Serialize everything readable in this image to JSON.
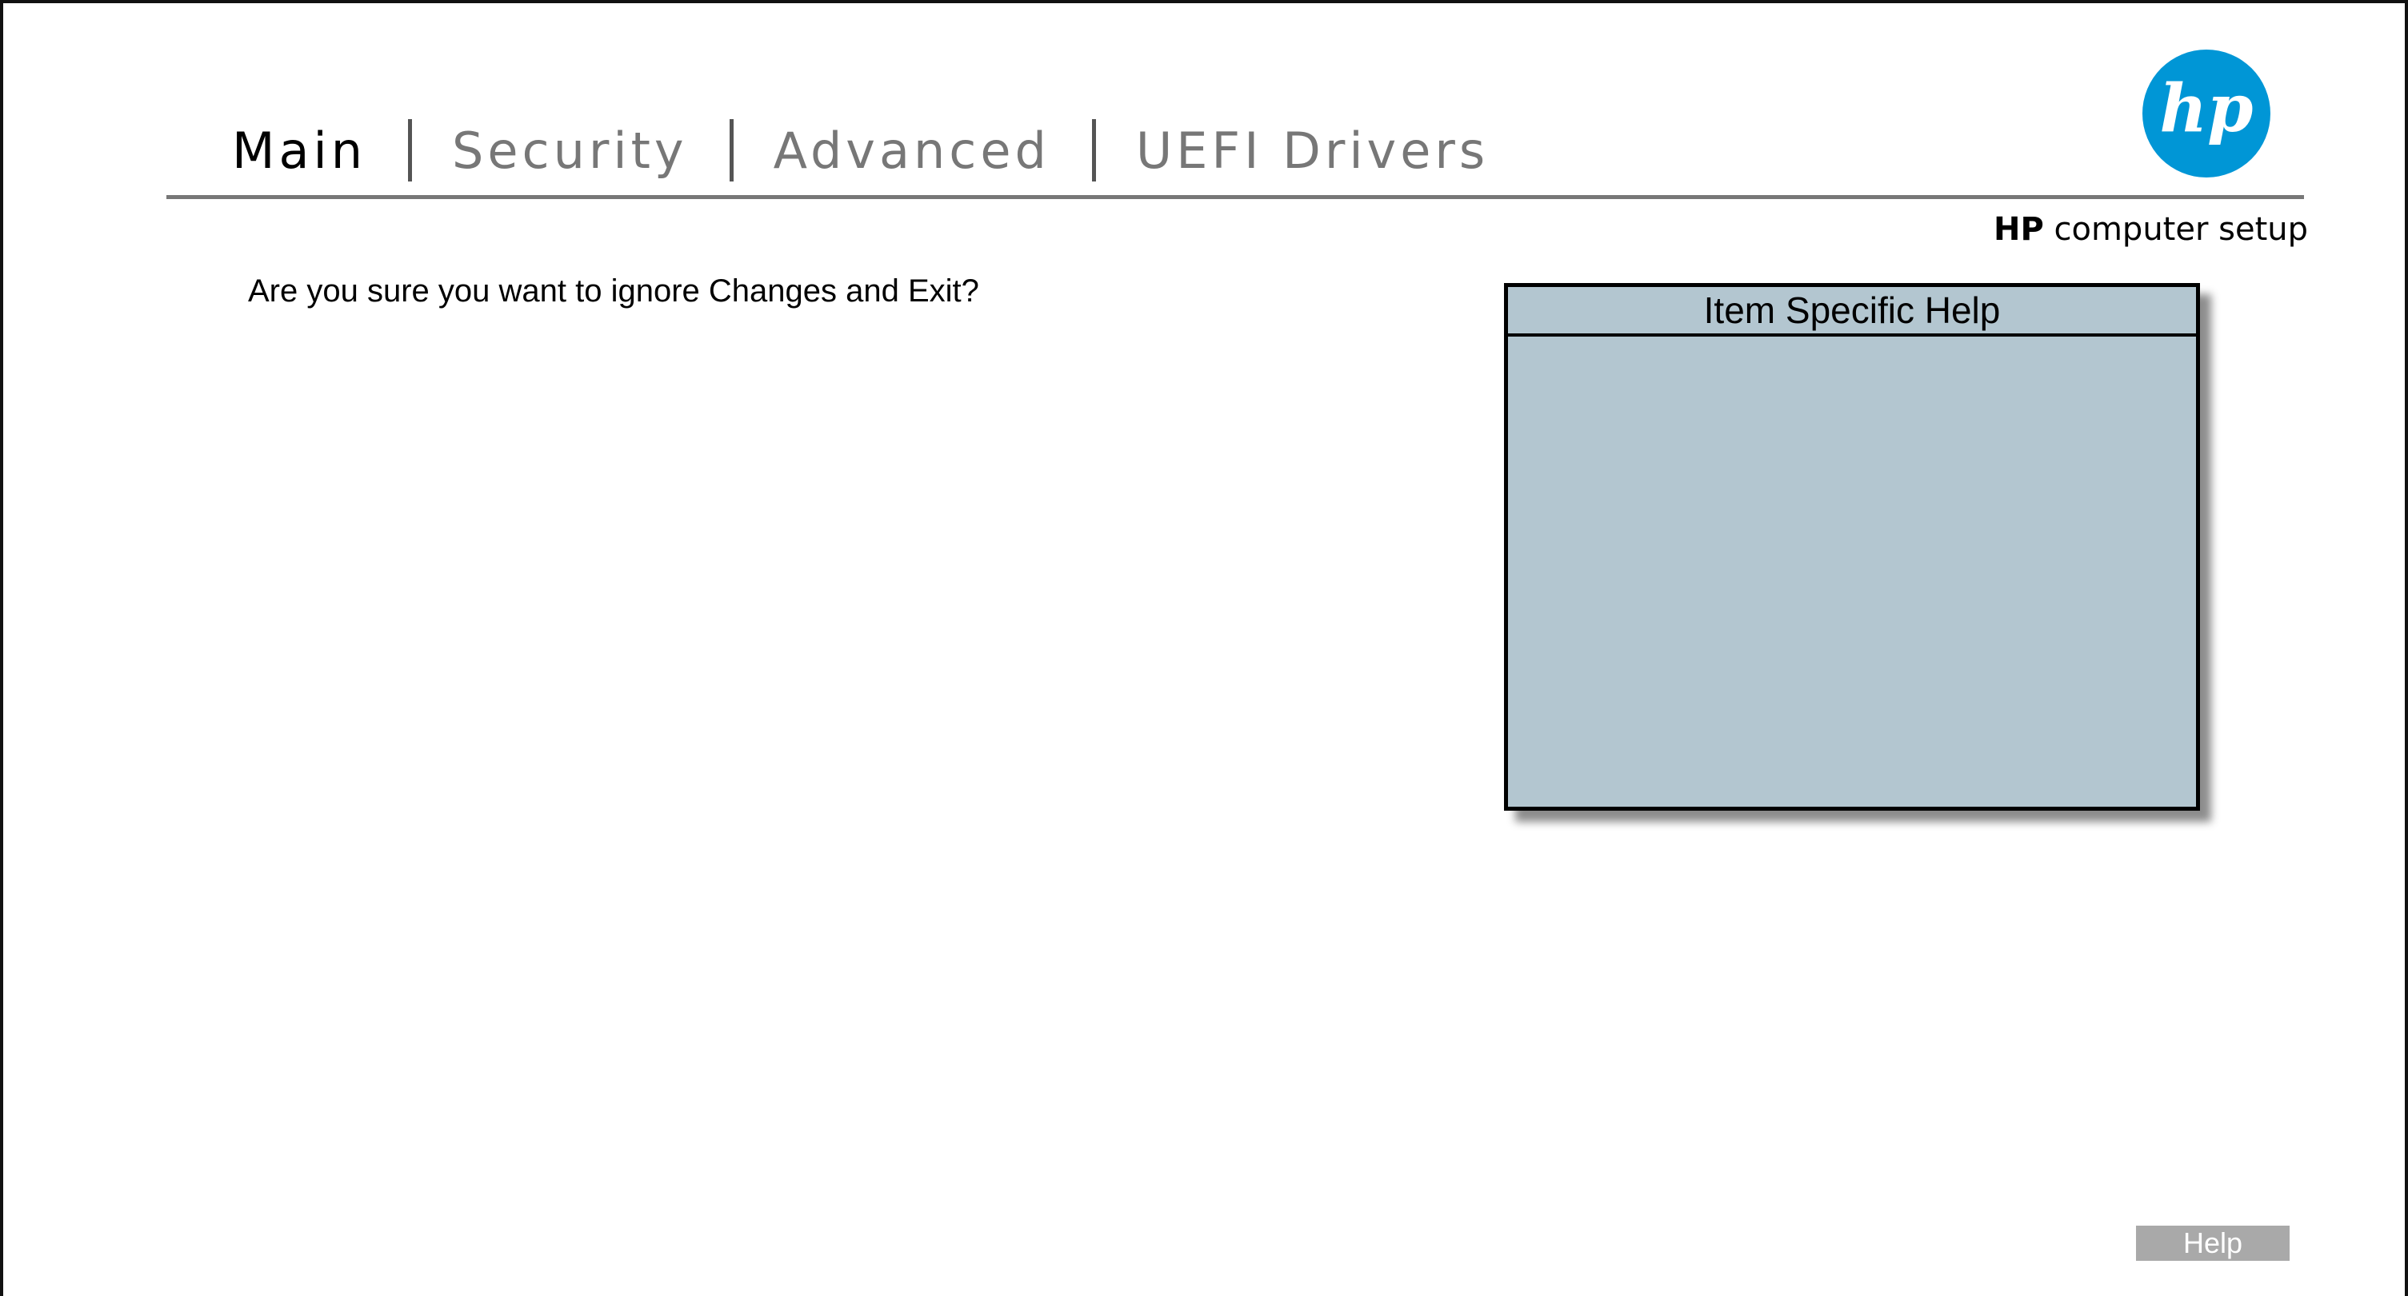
{
  "tabs": [
    {
      "label": "Main",
      "active": true
    },
    {
      "label": "Security",
      "active": false
    },
    {
      "label": "Advanced",
      "active": false
    },
    {
      "label": "UEFI Drivers",
      "active": false
    }
  ],
  "brand": {
    "logo_text": "hp",
    "logo_color": "#0096d6",
    "subtitle_bold": "HP",
    "subtitle_rest": " computer setup"
  },
  "dialog": {
    "question": "Are you sure you want to ignore Changes and Exit?"
  },
  "help_panel": {
    "title": "Item Specific Help",
    "body": "",
    "background_color": "#b3c6d0"
  },
  "footer": {
    "help_button_label": "Help"
  }
}
